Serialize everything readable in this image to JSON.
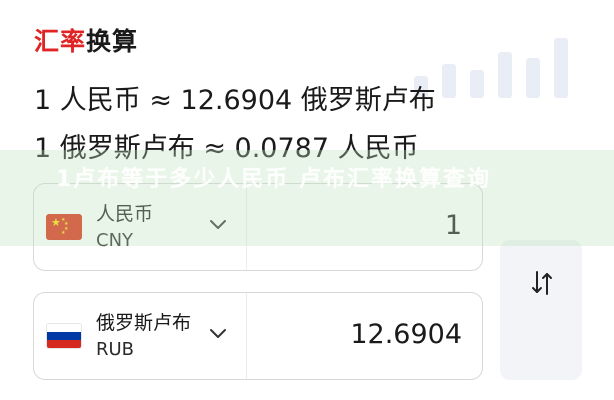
{
  "header": {
    "title_part1": "汇率",
    "title_part2": "换算"
  },
  "rates": {
    "line1": "1 人民币 ≈ 12.6904 俄罗斯卢布",
    "line2": "1 俄罗斯卢布 ≈ 0.0787 人民币"
  },
  "overlay": {
    "text": "1卢布等于多少人民币 卢布汇率换算查询"
  },
  "from_currency": {
    "name": "人民币",
    "code": "CNY",
    "amount": "1",
    "flag": "china-flag"
  },
  "to_currency": {
    "name": "俄罗斯卢布",
    "code": "RUB",
    "amount": "12.6904",
    "flag": "russia-flag"
  },
  "icons": {
    "dropdown": "chevron-down-icon",
    "swap": "swap-arrows-icon"
  },
  "colors": {
    "accent_red": "#e02424",
    "overlay_green": "#bee2be"
  }
}
